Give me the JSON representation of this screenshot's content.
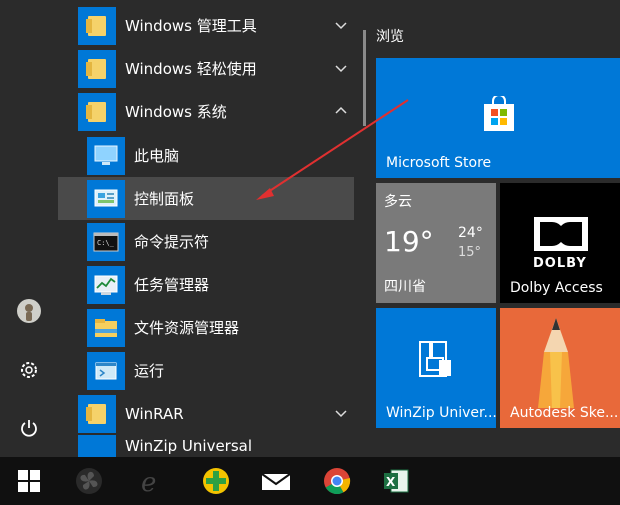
{
  "menu": {
    "items": [
      {
        "label": "Windows 管理工具",
        "icon": "folder-icon",
        "chevron": "chevron-down-icon"
      },
      {
        "label": "Windows 轻松使用",
        "icon": "folder-icon",
        "chevron": "chevron-down-icon"
      },
      {
        "label": "Windows 系统",
        "icon": "folder-icon",
        "chevron": "chevron-up-icon"
      },
      {
        "label": "此电脑",
        "icon": "this-pc-icon"
      },
      {
        "label": "控制面板",
        "icon": "control-panel-icon",
        "selected": true
      },
      {
        "label": "命令提示符",
        "icon": "command-prompt-icon"
      },
      {
        "label": "任务管理器",
        "icon": "task-manager-icon"
      },
      {
        "label": "文件资源管理器",
        "icon": "file-explorer-icon"
      },
      {
        "label": "运行",
        "icon": "run-icon"
      },
      {
        "label": "WinRAR",
        "icon": "folder-icon",
        "chevron": "chevron-down-icon"
      },
      {
        "label": "WinZip Universal",
        "icon": "winzip-icon"
      }
    ]
  },
  "tiles": {
    "header": "浏览",
    "store": {
      "label": "Microsoft Store",
      "icon": "store-bag-icon",
      "color": "#0078d7"
    },
    "weather": {
      "condition": "多云",
      "temp": "19°",
      "high": "24°",
      "low": "15°",
      "location": "四川省",
      "icon": "cloudy-icon",
      "color": "#7a7a7a"
    },
    "dolby": {
      "label": "Dolby Access",
      "logo_text": "DOLBY",
      "icon": "dolby-logo-icon",
      "color": "#000000"
    },
    "winzip": {
      "label": "WinZip Univer...",
      "icon": "winzip-icon",
      "color": "#0078d7"
    },
    "autodesk": {
      "label": "Autodesk Ske...",
      "icon": "pencil-icon",
      "color": "#e8693a"
    }
  },
  "rail": {
    "icons": [
      "user-avatar-icon",
      "settings-gear-icon",
      "power-icon"
    ]
  },
  "taskbar": {
    "icons": [
      "windows-start-icon",
      "fan-app-icon",
      "internet-explorer-icon",
      "360-security-icon",
      "mail-app-icon",
      "chrome-icon",
      "excel-icon"
    ]
  },
  "colors": {
    "accent": "#0078d7",
    "folder": "#f5d26a",
    "background": "#2b2b2b",
    "taskbar": "#101010",
    "annotation_arrow": "#e03030"
  }
}
